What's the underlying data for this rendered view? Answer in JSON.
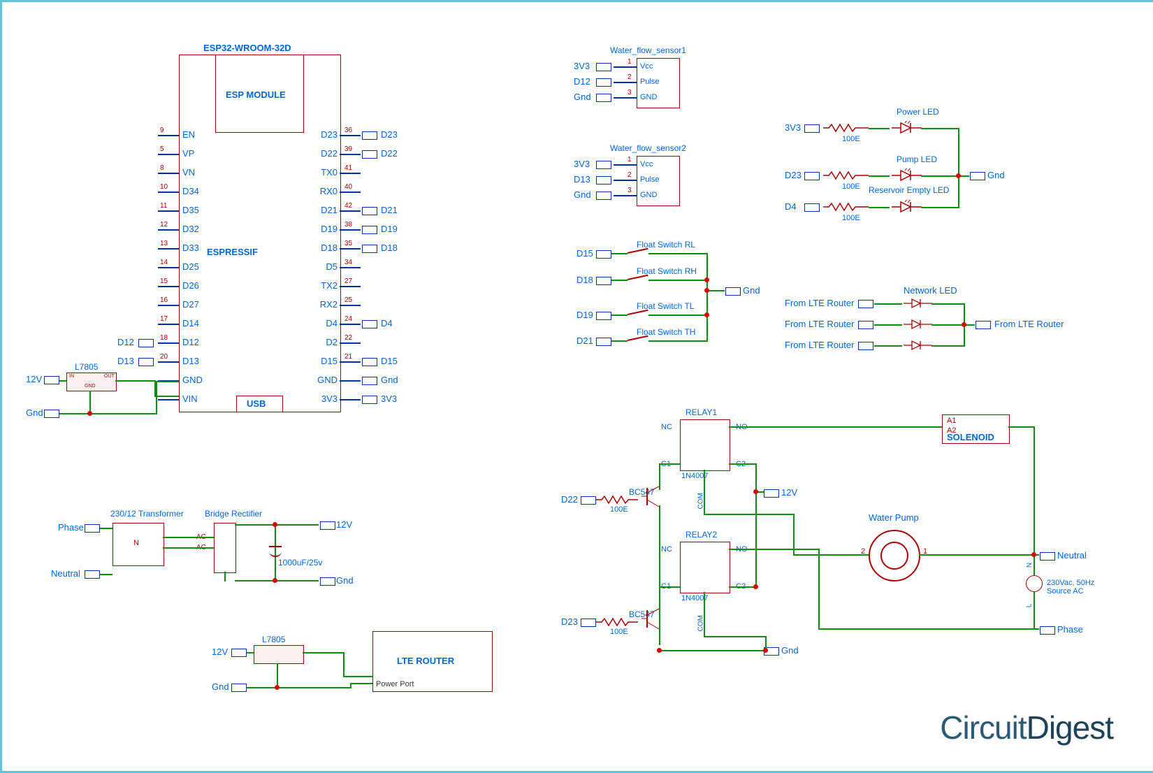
{
  "esp": {
    "title": "ESP32-WROOM-32D",
    "module": "ESP MODULE",
    "brand": "ESPRESSIF",
    "usb": "USB",
    "left_pins": [
      {
        "n": "9",
        "l": "EN"
      },
      {
        "n": "5",
        "l": "VP"
      },
      {
        "n": "8",
        "l": "VN"
      },
      {
        "n": "10",
        "l": "D34"
      },
      {
        "n": "11",
        "l": "D35"
      },
      {
        "n": "12",
        "l": "D32"
      },
      {
        "n": "13",
        "l": "D33"
      },
      {
        "n": "14",
        "l": "D25"
      },
      {
        "n": "15",
        "l": "D26"
      },
      {
        "n": "16",
        "l": "D27"
      },
      {
        "n": "17",
        "l": "D14"
      },
      {
        "n": "18",
        "l": "D12"
      },
      {
        "n": "20",
        "l": "D13"
      },
      {
        "n": "",
        "l": "GND"
      },
      {
        "n": "",
        "l": "VIN"
      }
    ],
    "right_pins": [
      {
        "n": "36",
        "l": "D23",
        "net": "D23"
      },
      {
        "n": "39",
        "l": "D22",
        "net": "D22"
      },
      {
        "n": "41",
        "l": "TX0"
      },
      {
        "n": "40",
        "l": "RX0"
      },
      {
        "n": "42",
        "l": "D21",
        "net": "D21"
      },
      {
        "n": "38",
        "l": "D19",
        "net": "D19"
      },
      {
        "n": "35",
        "l": "D18",
        "net": "D18"
      },
      {
        "n": "34",
        "l": "D5"
      },
      {
        "n": "27",
        "l": "TX2"
      },
      {
        "n": "25",
        "l": "RX2"
      },
      {
        "n": "24",
        "l": "D4",
        "net": "D4"
      },
      {
        "n": "22",
        "l": "D2"
      },
      {
        "n": "21",
        "l": "D15",
        "net": "D15"
      },
      {
        "n": "",
        "l": "GND",
        "net": "Gnd"
      },
      {
        "n": "",
        "l": "3V3",
        "net": "3V3"
      }
    ],
    "left_nets": {
      "D12": "D12",
      "D13": "D13"
    }
  },
  "reg1": {
    "name": "L7805",
    "in": "IN",
    "out": "OUT",
    "gnd": "GND",
    "src": "12V",
    "g": "Gnd"
  },
  "reg2": {
    "name": "L7805",
    "src": "12V",
    "g": "Gnd"
  },
  "psu": {
    "xfmr": "230/12 Transformer",
    "rect": "Bridge Rectifier",
    "cap": "1000uF/25v",
    "out12": "12V",
    "outg": "Gnd",
    "ph": "Phase",
    "nu": "Neutral",
    "n": "N",
    "ac": "AC"
  },
  "router": {
    "name": "LTE ROUTER",
    "port": "Power Port"
  },
  "wfs1": {
    "title": "Water_flow_sensor1",
    "p1": {
      "n": "1",
      "l": "Vcc",
      "net": "3V3"
    },
    "p2": {
      "n": "2",
      "l": "Pulse",
      "net": "D12"
    },
    "p3": {
      "n": "3",
      "l": "GND",
      "net": "Gnd"
    }
  },
  "wfs2": {
    "title": "Water_flow_sensor2",
    "p1": {
      "n": "1",
      "l": "Vcc",
      "net": "3V3"
    },
    "p2": {
      "n": "2",
      "l": "Pulse",
      "net": "D13"
    },
    "p3": {
      "n": "3",
      "l": "GND",
      "net": "Gnd"
    }
  },
  "floats": {
    "rl": {
      "name": "Float Switch RL",
      "net": "D15"
    },
    "rh": {
      "name": "Float Switch RH",
      "net": "D18"
    },
    "tl": {
      "name": "Float Switch TL",
      "net": "D19"
    },
    "th": {
      "name": "Float Switch TH",
      "net": "D21"
    },
    "g": "Gnd"
  },
  "leds": {
    "power": {
      "name": "Power LED",
      "r": "100E",
      "net": "3V3"
    },
    "pump": {
      "name": "Pump LED",
      "r": "100E",
      "net": "D23"
    },
    "empty": {
      "name": "Reservoir Empty LED",
      "r": "100E",
      "net": "D4"
    },
    "g": "Gnd"
  },
  "netled": {
    "title": "Network LED",
    "src": "From LTE Router",
    "dst": "From LTE Router"
  },
  "relay": {
    "r1": {
      "name": "RELAY1",
      "nc": "NC",
      "no": "NO",
      "c1": "C1",
      "c2": "C2",
      "d": "1N4007",
      "t": "BC547",
      "r": "100E",
      "net": "D22",
      "com": "COM"
    },
    "r2": {
      "name": "RELAY2",
      "nc": "NC",
      "no": "NO",
      "c1": "C1",
      "c2": "C2",
      "d": "1N4007",
      "t": "BC547",
      "r": "100E",
      "net": "D23",
      "com": "COM"
    },
    "v": "12V",
    "g": "Gnd"
  },
  "sol": {
    "name": "SOLENOID",
    "a1": "A1",
    "a2": "A2"
  },
  "pump": {
    "name": "Water Pump",
    "p1": "1",
    "p2": "2"
  },
  "ac": {
    "n": "Neutral",
    "ph": "Phase",
    "src": "230Vac, 50Hz\nSource AC",
    "L": "L",
    "N": "N"
  },
  "watermark": "CircuitDigest"
}
